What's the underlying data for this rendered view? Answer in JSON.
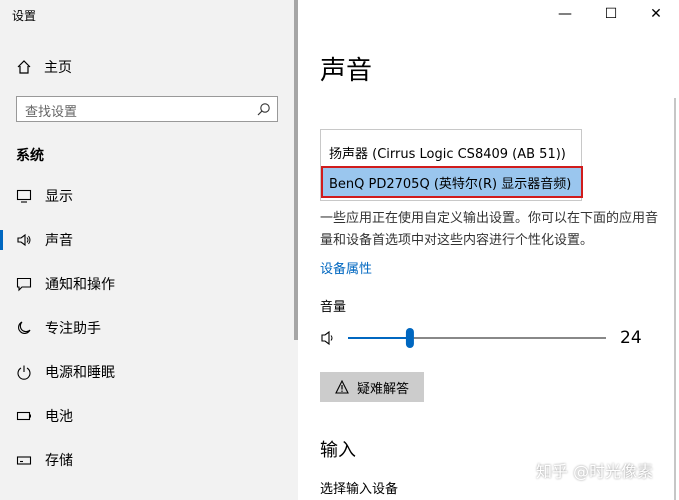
{
  "window": {
    "title": "设置",
    "controls": {
      "minimize": "—",
      "maximize": "☐",
      "close": "✕"
    }
  },
  "sidebar": {
    "home": {
      "label": "主页",
      "icon": "home-icon"
    },
    "search": {
      "placeholder": "查找设置",
      "icon": "search-icon"
    },
    "section": "系统",
    "items": [
      {
        "label": "显示",
        "icon": "monitor-icon",
        "active": false
      },
      {
        "label": "声音",
        "icon": "speaker-icon",
        "active": true
      },
      {
        "label": "通知和操作",
        "icon": "notification-icon",
        "active": false
      },
      {
        "label": "专注助手",
        "icon": "moon-icon",
        "active": false
      },
      {
        "label": "电源和睡眠",
        "icon": "power-icon",
        "active": false
      },
      {
        "label": "电池",
        "icon": "battery-icon",
        "active": false
      },
      {
        "label": "存储",
        "icon": "storage-icon",
        "active": false
      }
    ]
  },
  "main": {
    "title": "声音",
    "devices": [
      {
        "label": "扬声器 (Cirrus Logic CS8409 (AB 51))",
        "selected": false
      },
      {
        "label": "BenQ PD2705Q (英特尔(R) 显示器音频)",
        "selected": true
      }
    ],
    "info": "一些应用正在使用自定义输出设置。你可以在下面的应用音量和设备首选项中对这些内容进行个性化设置。",
    "device_properties": "设备属性",
    "volume": {
      "label": "音量",
      "value": "24",
      "level": 0.24
    },
    "troubleshoot": "疑难解答",
    "input": {
      "title": "输入",
      "subtitle": "选择输入设备"
    }
  },
  "watermark": "知乎 @时光像素",
  "colors": {
    "accent": "#0067c0",
    "selection": "#9ac6ee",
    "highlight_box": "#d01c1c"
  }
}
